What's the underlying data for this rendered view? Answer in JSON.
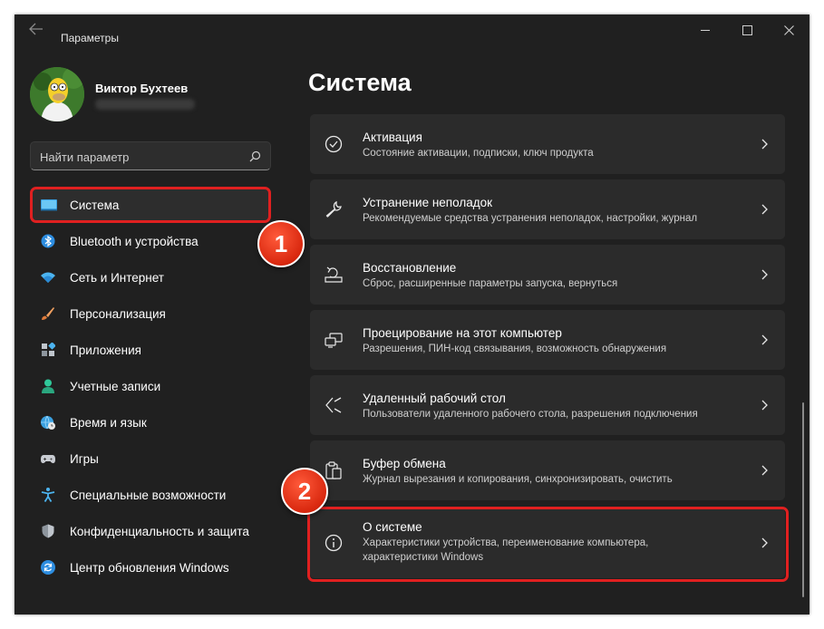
{
  "window": {
    "title": "Параметры"
  },
  "profile": {
    "name": "Виктор Бухтеев"
  },
  "search": {
    "placeholder": "Найти параметр"
  },
  "sidebar": {
    "items": [
      {
        "label": "Система",
        "icon": "system-icon",
        "selected": true
      },
      {
        "label": "Bluetooth и устройства",
        "icon": "bluetooth-icon"
      },
      {
        "label": "Сеть и Интернет",
        "icon": "wifi-icon"
      },
      {
        "label": "Персонализация",
        "icon": "brush-icon"
      },
      {
        "label": "Приложения",
        "icon": "apps-icon"
      },
      {
        "label": "Учетные записи",
        "icon": "person-icon"
      },
      {
        "label": "Время и язык",
        "icon": "globe-clock-icon"
      },
      {
        "label": "Игры",
        "icon": "gamepad-icon"
      },
      {
        "label": "Специальные возможности",
        "icon": "accessibility-icon"
      },
      {
        "label": "Конфиденциальность и защита",
        "icon": "shield-icon"
      },
      {
        "label": "Центр обновления Windows",
        "icon": "update-icon"
      }
    ]
  },
  "main": {
    "title": "Система",
    "cards": [
      {
        "title": "Активация",
        "subtitle": "Состояние активации, подписки, ключ продукта",
        "icon": "check-circle-icon"
      },
      {
        "title": "Устранение неполадок",
        "subtitle": "Рекомендуемые средства устранения неполадок, настройки, журнал",
        "icon": "wrench-icon"
      },
      {
        "title": "Восстановление",
        "subtitle": "Сброс, расширенные параметры запуска, вернуться",
        "icon": "recovery-icon"
      },
      {
        "title": "Проецирование на этот компьютер",
        "subtitle": "Разрешения, ПИН-код связывания, возможность обнаружения",
        "icon": "projection-icon"
      },
      {
        "title": "Удаленный рабочий стол",
        "subtitle": "Пользователи удаленного рабочего стола, разрешения подключения",
        "icon": "remote-desktop-icon"
      },
      {
        "title": "Буфер обмена",
        "subtitle": "Журнал вырезания и копирования, синхронизировать, очистить",
        "icon": "clipboard-icon"
      },
      {
        "title": "О системе",
        "subtitle": "Характеристики устройства, переименование компьютера, характеристики Windows",
        "icon": "info-icon"
      }
    ]
  },
  "annotations": {
    "badge1": "1",
    "badge2": "2",
    "highlight_color": "#e02020"
  },
  "colors": {
    "accent": "#4cc2ff",
    "background": "#202020",
    "card": "#2b2b2b"
  }
}
